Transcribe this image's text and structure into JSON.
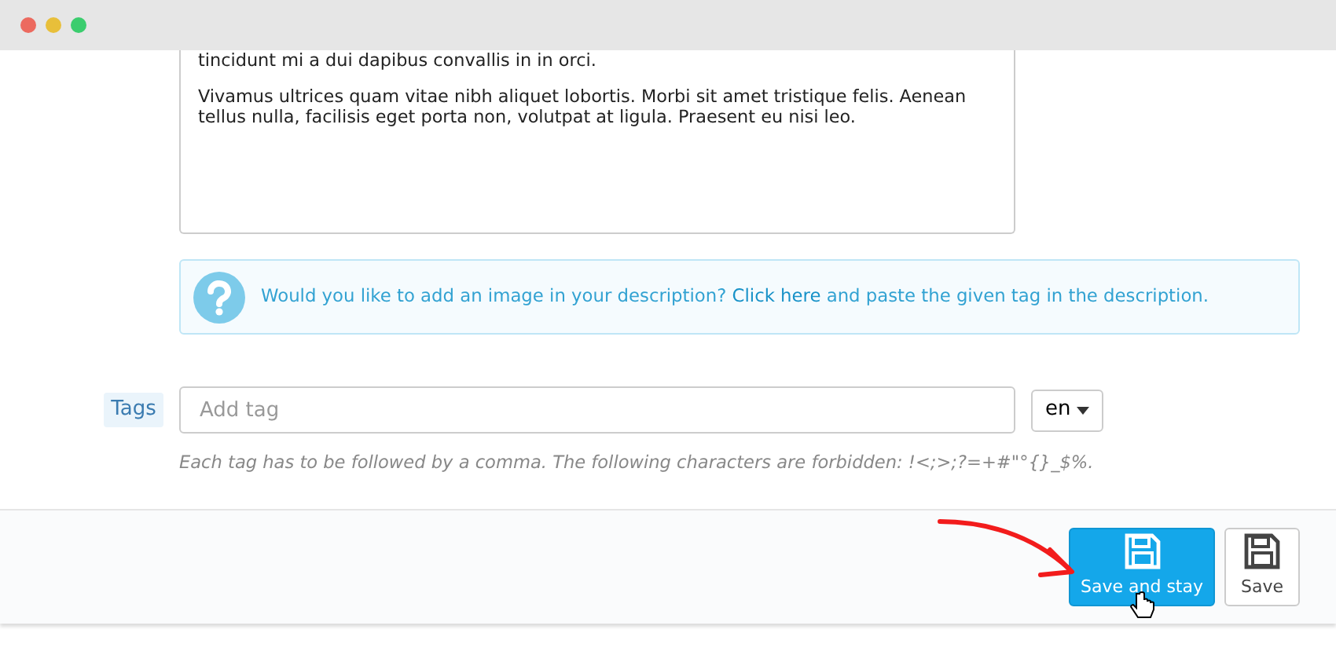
{
  "description": {
    "paragraphs": [
      "tincidunt mi a dui dapibus convallis in in orci.",
      "Vivamus ultrices quam vitae nibh aliquet lobortis. Morbi sit amet tristique felis. Aenean tellus nulla, facilisis eget porta non, volutpat at ligula. Praesent eu nisi leo."
    ]
  },
  "image_hint": {
    "before": "Would you like to add an image in your description?",
    "link": "Click here",
    "after": "and paste the given tag in the description."
  },
  "tags": {
    "label": "Tags",
    "placeholder": "Add tag",
    "language": "en",
    "help": "Each tag has to be followed by a comma. The following characters are forbidden: !<;>;?=+#\"°{}_$%."
  },
  "buttons": [
    {
      "label": "Save and stay",
      "kind": "primary"
    },
    {
      "label": "Save",
      "kind": "default"
    }
  ]
}
